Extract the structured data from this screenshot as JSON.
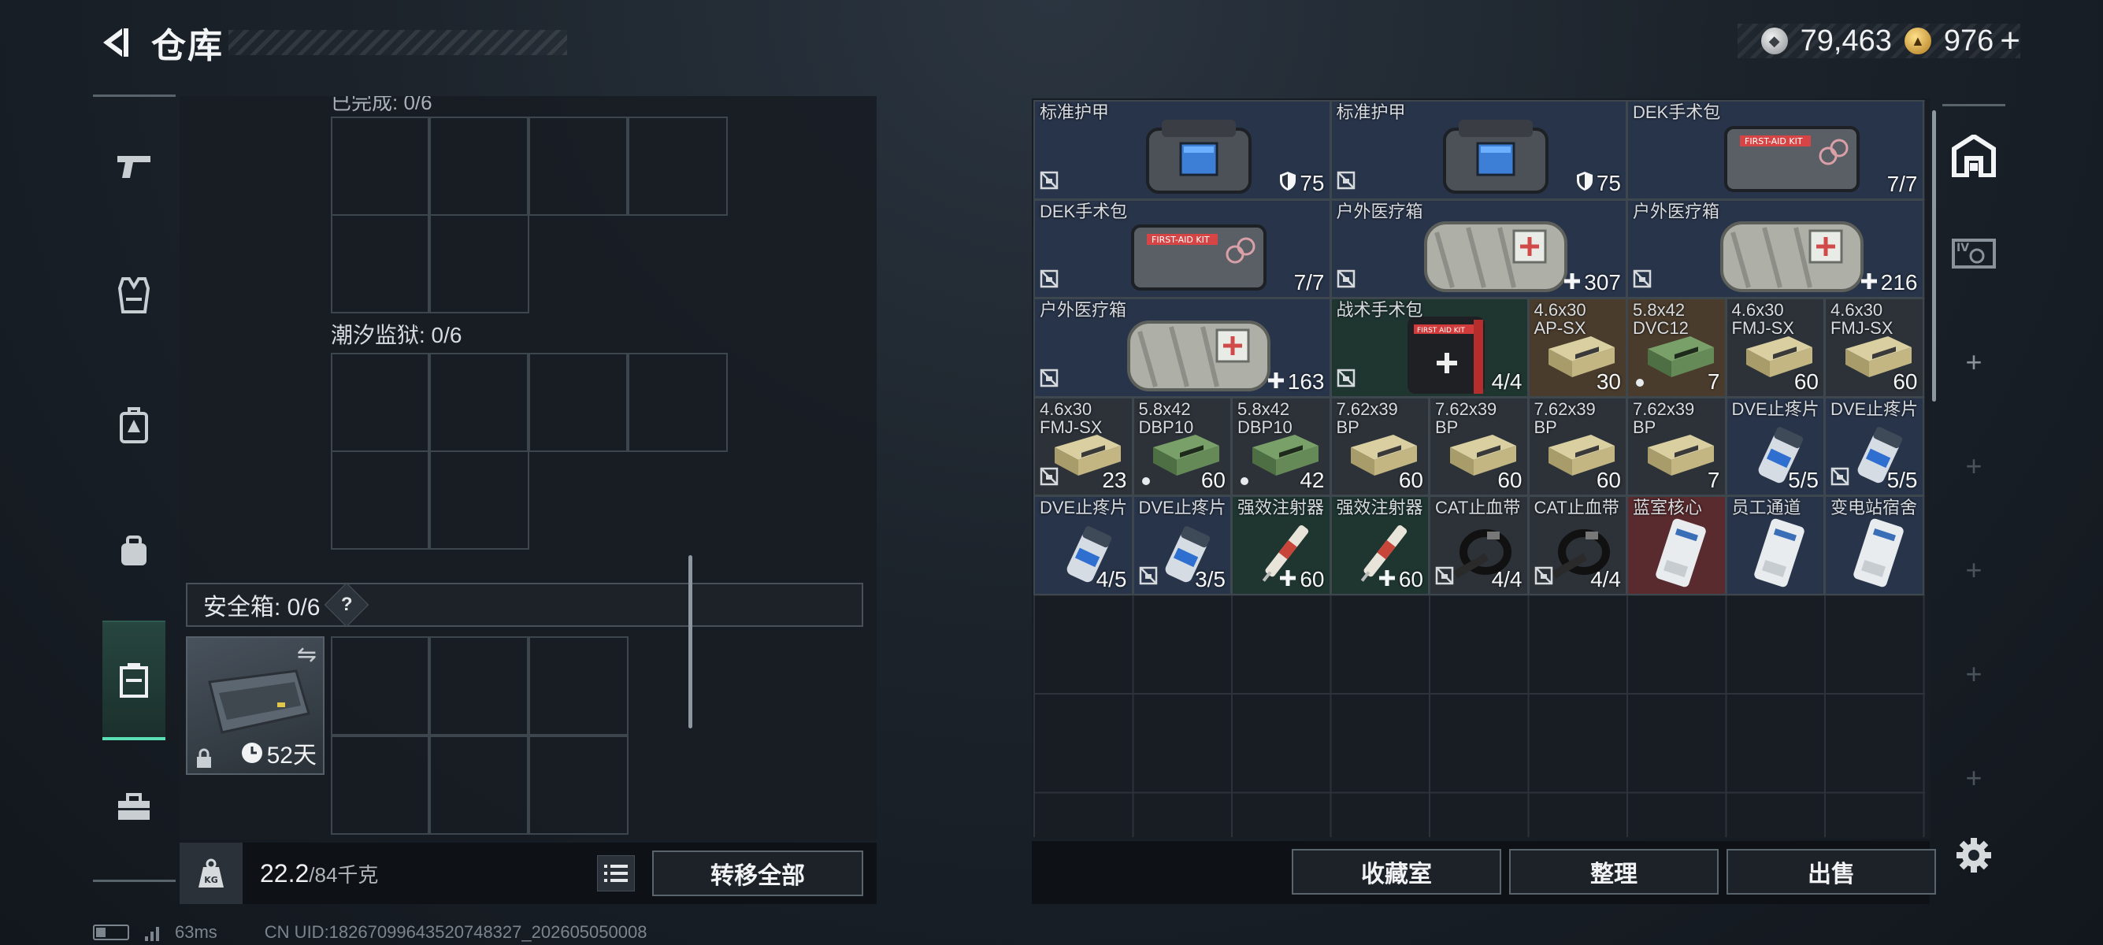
{
  "header": {
    "title": "仓库"
  },
  "currency": {
    "silver": "79,463",
    "gold": "976",
    "add_symbol": "+"
  },
  "left_panel": {
    "cut_label": "已完成: 0/6",
    "section2_label": "潮汐监狱: 0/6",
    "safe_box_label": "安全箱: 0/6",
    "help_label": "?",
    "safe_box_timer": "52天"
  },
  "footer_left": {
    "weight_value": "22.2",
    "weight_max": "/84千克",
    "transfer_all": "转移全部"
  },
  "status": {
    "ping": "63ms",
    "uid": "CN UID:18267099643520748327_202605050008"
  },
  "stash_items": [
    {
      "name": "标准护甲",
      "value": "75",
      "value_icon": "shield-icon",
      "insured": false,
      "color": "blue"
    },
    {
      "name": "标准护甲",
      "value": "75",
      "value_icon": "shield-icon",
      "insured": false,
      "color": "blue"
    },
    {
      "name": "DEK手术包",
      "value": "7/7",
      "value_icon": "",
      "insured": true,
      "color": "blue"
    },
    {
      "name": "DEK手术包",
      "value": "7/7",
      "value_icon": "",
      "insured": false,
      "color": "blue"
    },
    {
      "name": "户外医疗箱",
      "value": "307",
      "value_icon": "plus-icon",
      "insured": false,
      "color": "blue"
    },
    {
      "name": "户外医疗箱",
      "value": "216",
      "value_icon": "plus-icon",
      "insured": false,
      "color": "blue"
    },
    {
      "name": "户外医疗箱",
      "value": "163",
      "value_icon": "plus-icon",
      "insured": false,
      "color": "blue"
    },
    {
      "name": "战术手术包",
      "value": "4/4",
      "value_icon": "",
      "insured": false,
      "color": "stim"
    },
    {
      "name": "4.6x30\nAP-SX",
      "value": "30",
      "insured": true,
      "color": "ammo-brown"
    },
    {
      "name": "5.8x42\nDVC12",
      "value": "7",
      "insured": true,
      "dot": true,
      "color": "ammo-brown"
    },
    {
      "name": "4.6x30\nFMJ-SX",
      "value": "60",
      "insured": true,
      "color": "ammo"
    },
    {
      "name": "4.6x30\nFMJ-SX",
      "value": "60",
      "insured": true,
      "color": "ammo"
    },
    {
      "name": "4.6x30\nFMJ-SX",
      "value": "23",
      "insured": false,
      "color": "ammo"
    },
    {
      "name": "5.8x42\nDBP10",
      "value": "60",
      "insured": true,
      "dot": true,
      "color": "ammo"
    },
    {
      "name": "5.8x42\nDBP10",
      "value": "42",
      "insured": true,
      "dot": true,
      "color": "ammo"
    },
    {
      "name": "7.62x39\nBP",
      "value": "60",
      "insured": true,
      "color": "ammo"
    },
    {
      "name": "7.62x39\nBP",
      "value": "60",
      "insured": true,
      "color": "ammo"
    },
    {
      "name": "7.62x39\nBP",
      "value": "60",
      "insured": true,
      "color": "ammo"
    },
    {
      "name": "7.62x39\nBP",
      "value": "7",
      "insured": true,
      "color": "ammo"
    },
    {
      "name": "DVE止疼片",
      "value": "5/5",
      "insured": true,
      "color": "blue"
    },
    {
      "name": "DVE止疼片",
      "value": "5/5",
      "insured": false,
      "color": "blue"
    },
    {
      "name": "DVE止疼片",
      "value": "4/5",
      "insured": true,
      "color": "blue"
    },
    {
      "name": "DVE止疼片",
      "value": "3/5",
      "insured": false,
      "color": "blue"
    },
    {
      "name": "强效注射器",
      "value": "60",
      "value_icon": "plus-icon",
      "insured": true,
      "color": "stim"
    },
    {
      "name": "强效注射器",
      "value": "60",
      "value_icon": "plus-icon",
      "insured": true,
      "color": "stim"
    },
    {
      "name": "CAT止血带",
      "value": "4/4",
      "insured": false,
      "color": "ammo"
    },
    {
      "name": "CAT止血带",
      "value": "4/4",
      "insured": false,
      "color": "ammo"
    },
    {
      "name": "蓝室核心",
      "value": "",
      "insured": true,
      "color": "red"
    },
    {
      "name": "员工通道",
      "value": "",
      "insured": true,
      "color": "blue"
    },
    {
      "name": "变电站宿舍",
      "value": "",
      "insured": true,
      "color": "blue"
    }
  ],
  "footer_right": {
    "collection": "收藏室",
    "organize": "整理",
    "sell": "出售"
  },
  "right_nav": {
    "add_symbol": "+"
  },
  "colors": {
    "accent": "#5be0b5",
    "panel": "#181d23",
    "border": "#3e464e"
  }
}
